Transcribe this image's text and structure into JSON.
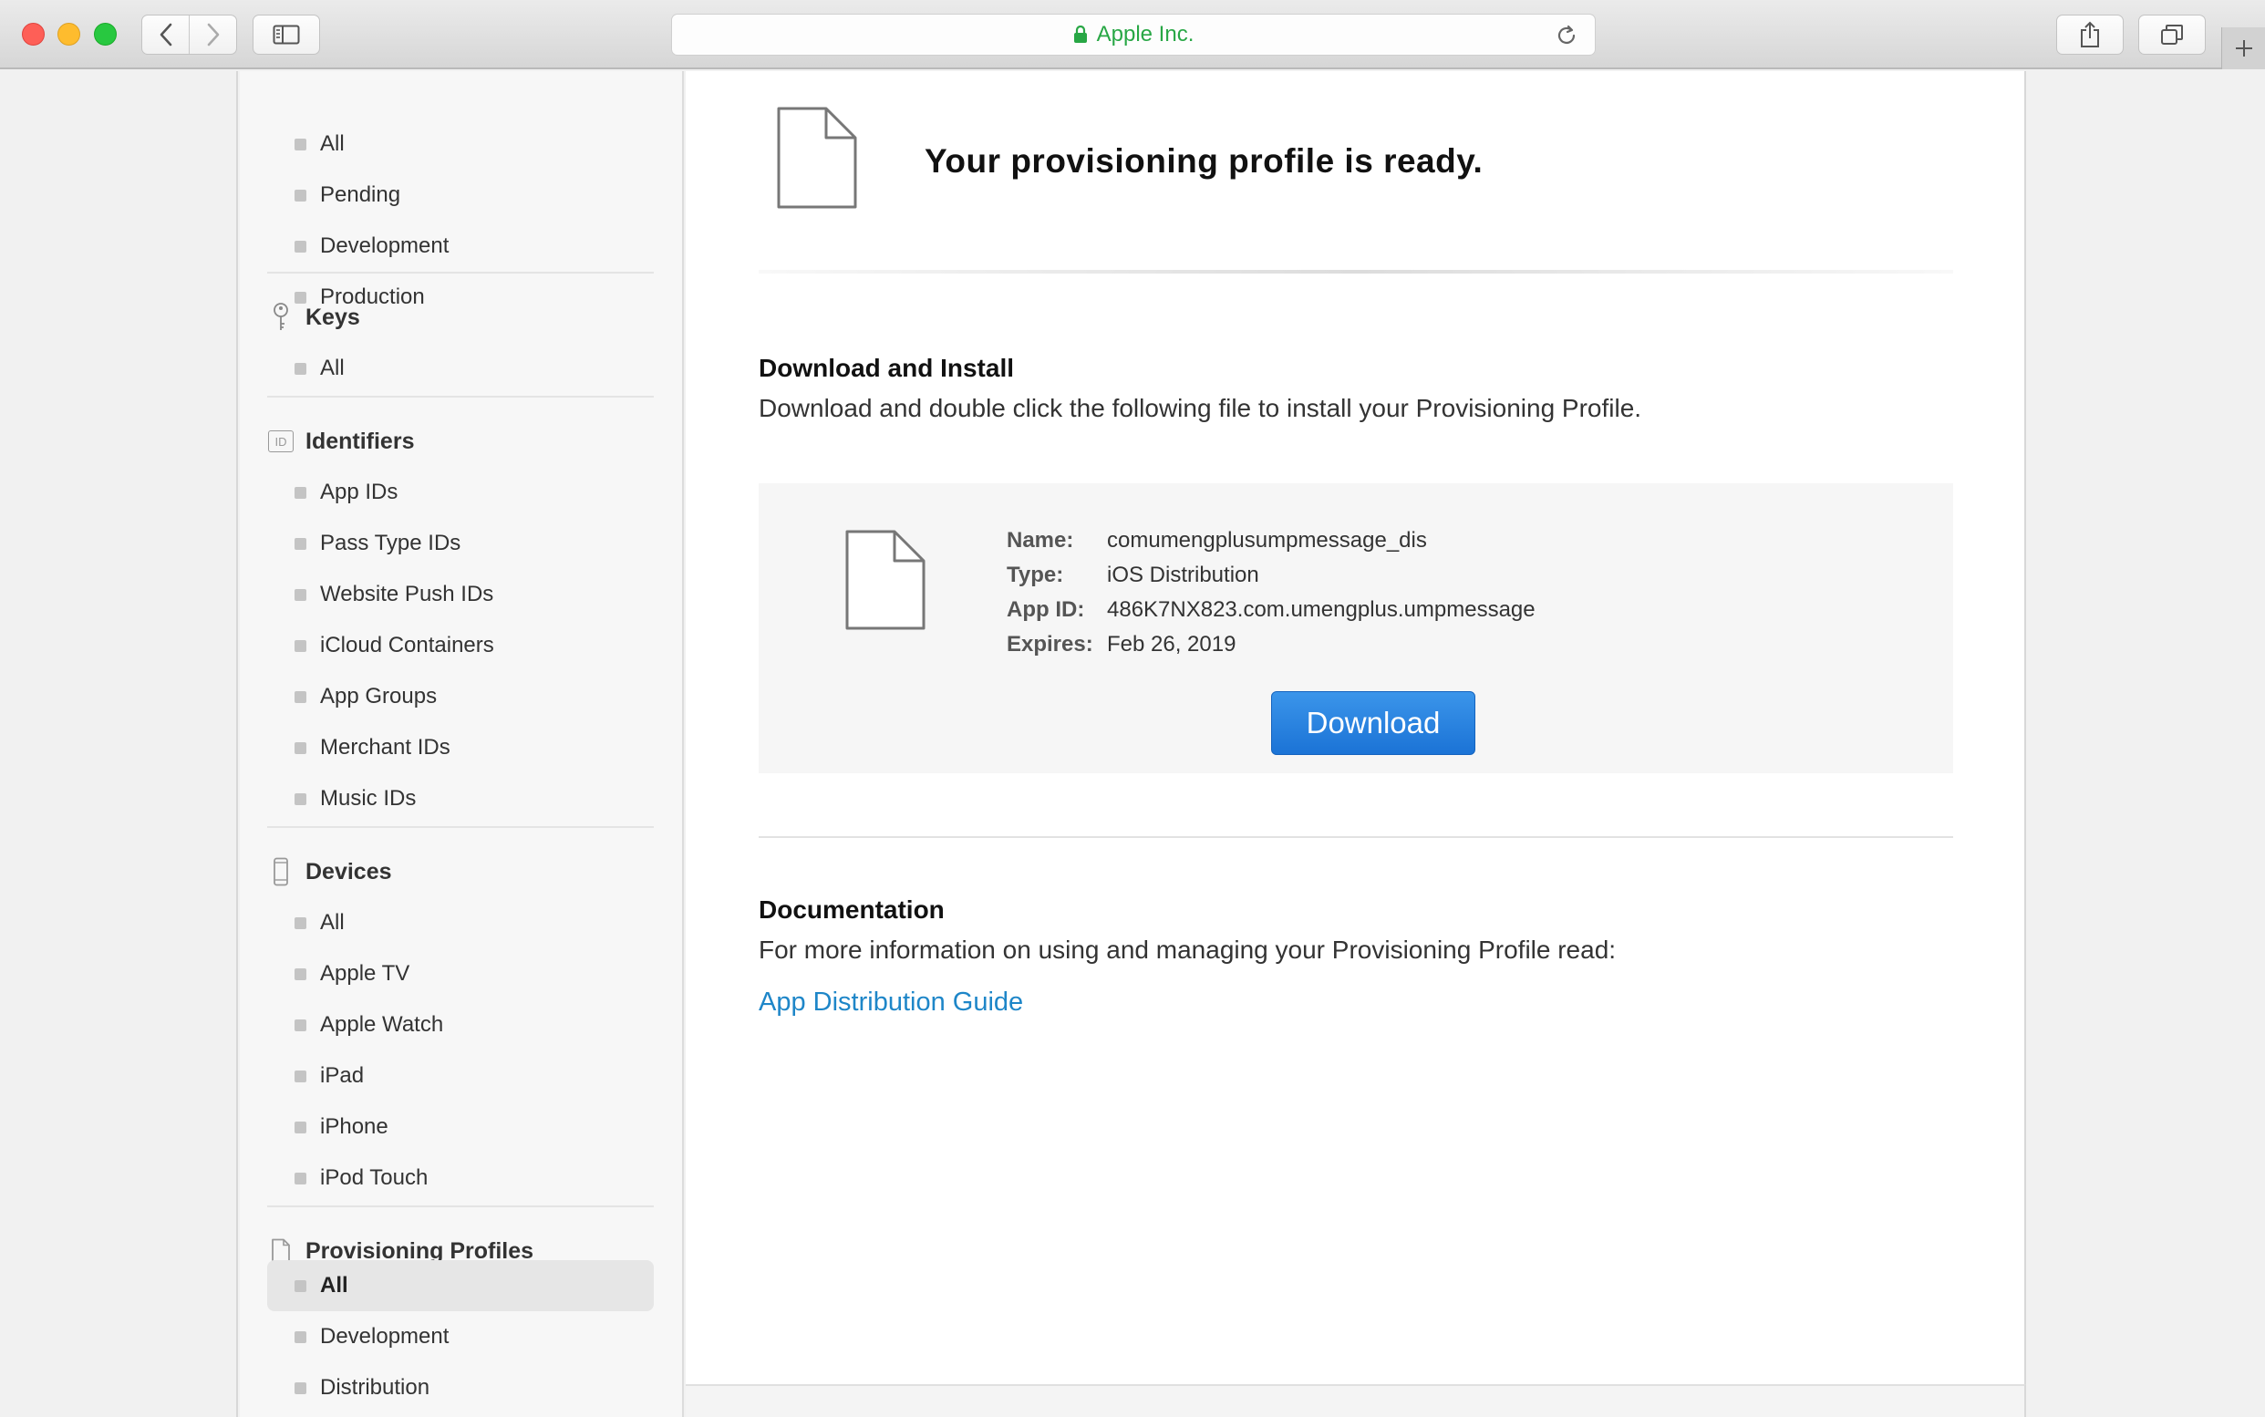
{
  "browser": {
    "address_text": "Apple Inc."
  },
  "sidebar": {
    "top_items": [
      "All",
      "Pending",
      "Development",
      "Production"
    ],
    "sections": [
      {
        "title": "Keys",
        "icon": "key-icon",
        "items": [
          "All"
        ]
      },
      {
        "title": "Identifiers",
        "icon": "id-badge-icon",
        "items": [
          "App IDs",
          "Pass Type IDs",
          "Website Push IDs",
          "iCloud Containers",
          "App Groups",
          "Merchant IDs",
          "Music IDs"
        ]
      },
      {
        "title": "Devices",
        "icon": "phone-device-icon",
        "items": [
          "All",
          "Apple TV",
          "Apple Watch",
          "iPad",
          "iPhone",
          "iPod Touch"
        ]
      },
      {
        "title": "Provisioning Profiles",
        "icon": "document-icon",
        "items": [
          "All",
          "Development",
          "Distribution"
        ],
        "active_item": "All"
      }
    ],
    "id_icon_text": "ID"
  },
  "main": {
    "ready_title": "Your provisioning profile is ready.",
    "download_section": {
      "title": "Download and Install",
      "description": "Download and double click the following file to install your Provisioning Profile."
    },
    "profile": {
      "name_label": "Name:",
      "name_value": "comumengplusumpmessage_dis",
      "type_label": "Type:",
      "type_value": "iOS Distribution",
      "appid_label": "App ID:",
      "appid_value": "486K7NX823.com.umengplus.umpmessage",
      "expires_label": "Expires:",
      "expires_value": "Feb 26, 2019",
      "download_label": "Download"
    },
    "documentation": {
      "title": "Documentation",
      "description": "For more information on using and managing your Provisioning Profile read:",
      "link_text": "App Distribution Guide"
    }
  },
  "colors": {
    "accent_blue": "#1b73d6",
    "link_blue": "#1e86c8",
    "secure_green": "#28a745"
  }
}
